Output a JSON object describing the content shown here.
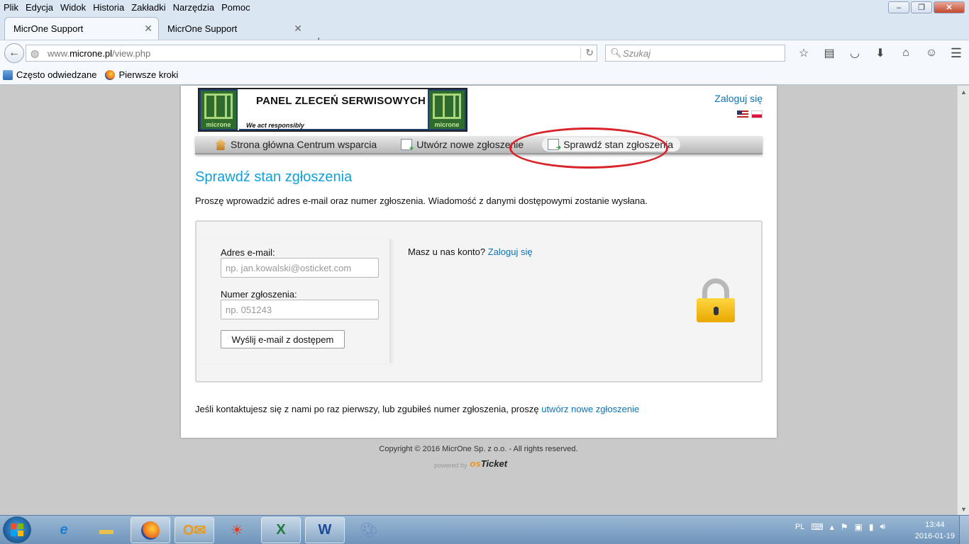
{
  "menubar": [
    "Plik",
    "Edycja",
    "Widok",
    "Historia",
    "Zakładki",
    "Narzędzia",
    "Pomoc"
  ],
  "tabs": [
    {
      "label": "MicrOne Support",
      "active": true
    },
    {
      "label": "MicrOne Support",
      "active": false
    }
  ],
  "address": {
    "prefix": "www.",
    "domain": "microne.pl",
    "path": "/view.php"
  },
  "search": {
    "placeholder": "Szukaj"
  },
  "bookmarks": [
    "Często odwiedzane",
    "Pierwsze kroki"
  ],
  "site": {
    "logo_title": "PANEL ZLECEŃ SERWISOWYCH",
    "logo_tagline": "We act responsibly",
    "logo_brand": "microne",
    "login_link": "Zaloguj się",
    "nav": [
      "Strona główna Centrum wsparcia",
      "Utwórz nowe zgłoszenie",
      "Sprawdź stan zgłoszenia"
    ],
    "heading": "Sprawdź stan zgłoszenia",
    "intro": "Proszę wprowadzić adres e-mail oraz numer zgłoszenia. Wiadomość z danymi dostępowymi zostanie wysłana.",
    "form": {
      "email_label": "Adres e-mail:",
      "email_placeholder": "np. jan.kowalski@osticket.com",
      "ticket_label": "Numer zgłoszenia:",
      "ticket_placeholder": "np. 051243",
      "submit": "Wyślij e-mail z dostępem"
    },
    "account_question": "Masz u nas konto?",
    "account_login": "Zaloguj się",
    "bottom_note": "Jeśli kontaktujesz się z nami po raz pierwszy, lub zgubiłeś numer zgłoszenia, proszę",
    "bottom_link": "utwórz nowe zgłoszenie",
    "copyright": "Copyright © 2016 MicrOne Sp. z o.o. - All rights reserved.",
    "powered_by": "powered by",
    "powered_brand_os": "os",
    "powered_brand_ticket": "Ticket"
  },
  "taskbar": {
    "lang": "PL",
    "time": "13:44",
    "date": "2016-01-19"
  },
  "colors": {
    "accent": "#11a0d8",
    "link": "#0a74b8",
    "highlight": "#d8232a"
  }
}
